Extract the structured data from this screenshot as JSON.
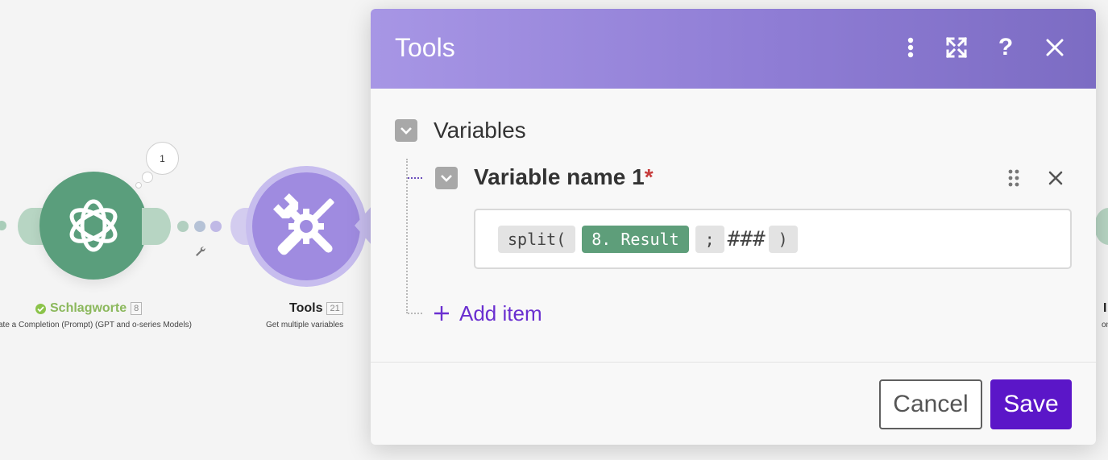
{
  "canvas": {
    "modules": [
      {
        "title": "Schlagworte",
        "badge": "8",
        "subtitle": "ate a Completion (Prompt) (GPT and o-series Models)",
        "icon": "openai-icon",
        "color": "#5a9e7c",
        "status": "success-check-icon",
        "bubble": "1"
      },
      {
        "title": "Tools",
        "badge": "21",
        "subtitle": "Get multiple variables",
        "icon": "tools-icon",
        "color": "#9f8be0"
      },
      {
        "title": "I",
        "subtitle": "omp",
        "color": "#5a9e7c"
      }
    ],
    "link_icon": "wrench-icon"
  },
  "modal": {
    "title": "Tools",
    "header_icons": [
      "more-vertical-icon",
      "expand-icon",
      "help-icon",
      "close-icon"
    ],
    "help_glyph": "?",
    "section_label": "Variables",
    "item": {
      "label": "Variable name 1",
      "required_mark": "*",
      "expression": {
        "fn_open": "split(",
        "variable": "8. Result",
        "separator": ";",
        "literal": "###",
        "fn_close": ")"
      }
    },
    "add_item_label": "Add item",
    "cancel_label": "Cancel",
    "save_label": "Save"
  },
  "colors": {
    "header_gradient_start": "#a796e5",
    "header_gradient_end": "#7c6cc3",
    "accent_purple": "#6a2fd0",
    "save_button": "#5b16c8",
    "variable_pill": "#5e9e7a",
    "required": "#c63b3b"
  }
}
